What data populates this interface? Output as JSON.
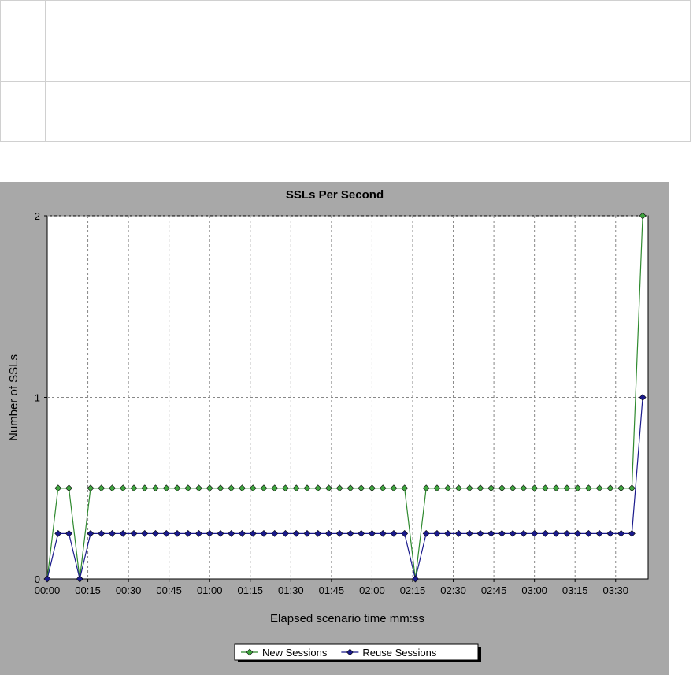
{
  "chart_data": {
    "type": "line",
    "title": "SSLs Per Second",
    "xlabel": "Elapsed scenario time mm:ss",
    "ylabel": "Number of SSLs",
    "x_tick_labels": [
      "00:00",
      "00:15",
      "00:30",
      "00:45",
      "01:00",
      "01:15",
      "01:30",
      "01:45",
      "02:00",
      "02:15",
      "02:30",
      "02:45",
      "03:00",
      "03:15",
      "03:30"
    ],
    "y_tick_labels": [
      "0",
      "1",
      "2"
    ],
    "xlim_seconds": [
      0,
      222
    ],
    "ylim": [
      0,
      2
    ],
    "grid": true,
    "legend_placement": "bottom-center",
    "x_seconds": [
      0,
      4,
      8,
      12,
      16,
      20,
      24,
      28,
      32,
      36,
      40,
      44,
      48,
      52,
      56,
      60,
      64,
      68,
      72,
      76,
      80,
      84,
      88,
      92,
      96,
      100,
      104,
      108,
      112,
      116,
      120,
      124,
      128,
      132,
      136,
      140,
      144,
      148,
      152,
      156,
      160,
      164,
      168,
      172,
      176,
      180,
      184,
      188,
      192,
      196,
      200,
      204,
      208,
      212,
      216,
      220
    ],
    "series": [
      {
        "name": "New Sessions",
        "color": "#2f8a2f",
        "marker_fill": "#3fa63f",
        "values": [
          0,
          0.5,
          0.5,
          0,
          0.5,
          0.5,
          0.5,
          0.5,
          0.5,
          0.5,
          0.5,
          0.5,
          0.5,
          0.5,
          0.5,
          0.5,
          0.5,
          0.5,
          0.5,
          0.5,
          0.5,
          0.5,
          0.5,
          0.5,
          0.5,
          0.5,
          0.5,
          0.5,
          0.5,
          0.5,
          0.5,
          0.5,
          0.5,
          0.5,
          0,
          0.5,
          0.5,
          0.5,
          0.5,
          0.5,
          0.5,
          0.5,
          0.5,
          0.5,
          0.5,
          0.5,
          0.5,
          0.5,
          0.5,
          0.5,
          0.5,
          0.5,
          0.5,
          0.5,
          0.5,
          2
        ]
      },
      {
        "name": "Reuse Sessions",
        "color": "#1a1a8c",
        "marker_fill": "#1a1a8c",
        "values": [
          0,
          0.25,
          0.25,
          0,
          0.25,
          0.25,
          0.25,
          0.25,
          0.25,
          0.25,
          0.25,
          0.25,
          0.25,
          0.25,
          0.25,
          0.25,
          0.25,
          0.25,
          0.25,
          0.25,
          0.25,
          0.25,
          0.25,
          0.25,
          0.25,
          0.25,
          0.25,
          0.25,
          0.25,
          0.25,
          0.25,
          0.25,
          0.25,
          0.25,
          0,
          0.25,
          0.25,
          0.25,
          0.25,
          0.25,
          0.25,
          0.25,
          0.25,
          0.25,
          0.25,
          0.25,
          0.25,
          0.25,
          0.25,
          0.25,
          0.25,
          0.25,
          0.25,
          0.25,
          0.25,
          1
        ]
      }
    ]
  }
}
